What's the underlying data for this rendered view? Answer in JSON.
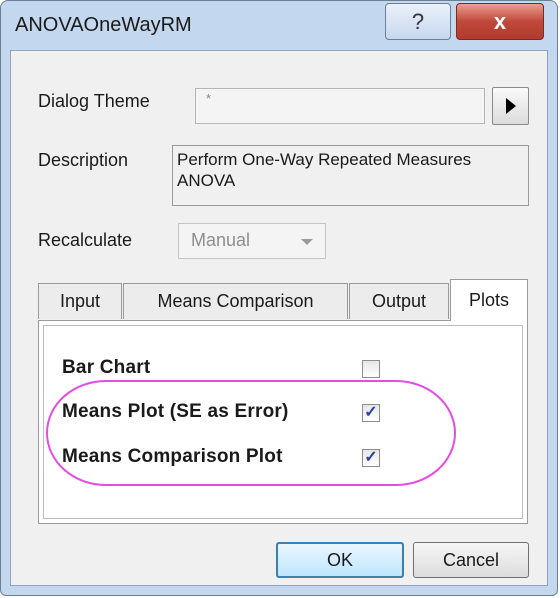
{
  "window": {
    "title": "ANOVAOneWayRM"
  },
  "title_buttons": {
    "help": "?",
    "close": "x"
  },
  "dialog_theme": {
    "label": "Dialog Theme",
    "value": "*"
  },
  "description": {
    "label": "Description",
    "text": "Perform One-Way Repeated Measures ANOVA"
  },
  "recalculate": {
    "label": "Recalculate",
    "selected": "Manual"
  },
  "tabs": [
    {
      "label": "Input",
      "active": false
    },
    {
      "label": "Means Comparison",
      "active": false
    },
    {
      "label": "Output",
      "active": false
    },
    {
      "label": "Plots",
      "active": true
    }
  ],
  "plots": {
    "bar_chart": {
      "label": "Bar Chart",
      "checked": false
    },
    "means_plot": {
      "label": "Means Plot (SE as Error)",
      "checked": true
    },
    "means_comparison_plot": {
      "label": "Means Comparison Plot",
      "checked": true
    }
  },
  "buttons": {
    "ok": "OK",
    "cancel": "Cancel"
  },
  "colors": {
    "highlight": "#e64be6",
    "title_bar": "#c3d7ee",
    "close_button": "#c0483a"
  }
}
